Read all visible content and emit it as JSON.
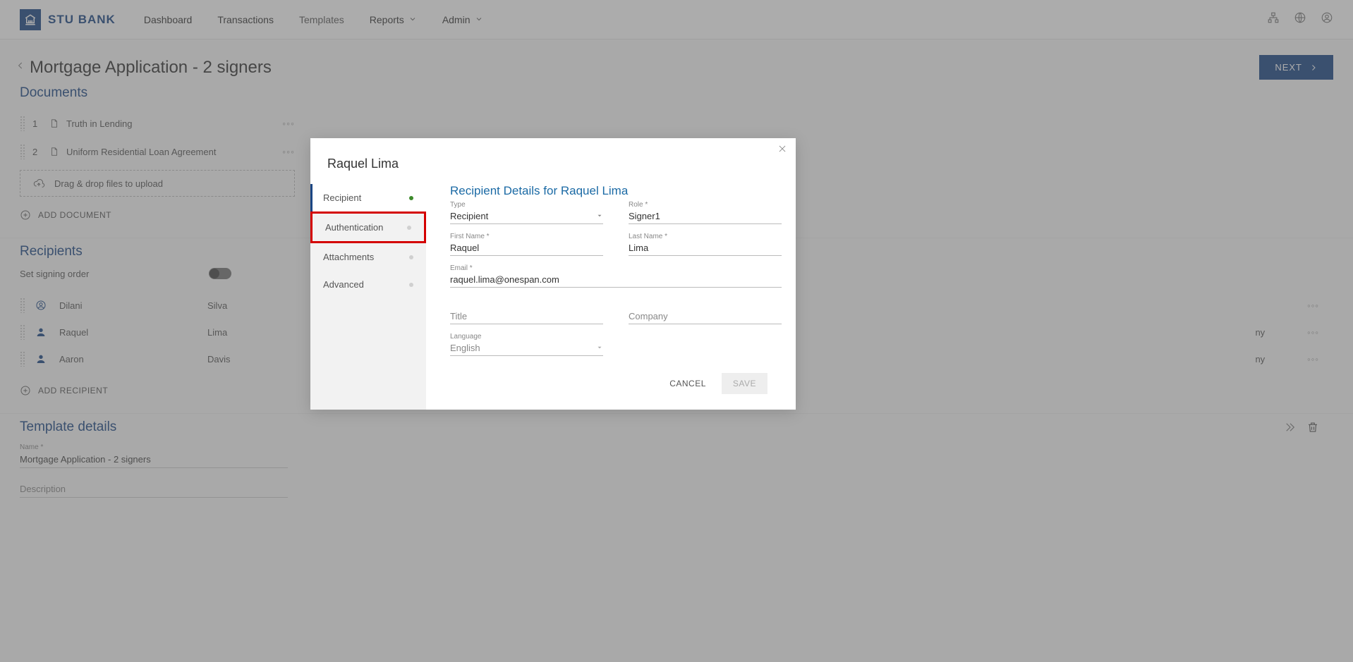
{
  "brand": {
    "name": "STU BANK"
  },
  "nav": {
    "items": [
      {
        "label": "Dashboard"
      },
      {
        "label": "Transactions"
      },
      {
        "label": "Templates"
      },
      {
        "label": "Reports"
      },
      {
        "label": "Admin"
      }
    ]
  },
  "page": {
    "title": "Mortgage Application - 2 signers",
    "next": "NEXT"
  },
  "documents": {
    "heading": "Documents",
    "items": [
      {
        "num": "1",
        "name": "Truth in Lending"
      },
      {
        "num": "2",
        "name": "Uniform Residential Loan Agreement"
      }
    ],
    "drop": "Drag & drop files to upload",
    "add": "ADD DOCUMENT"
  },
  "recipients": {
    "heading": "Recipients",
    "order_label": "Set signing order",
    "items": [
      {
        "first": "Dilani",
        "last": "Silva",
        "me": true
      },
      {
        "first": "Raquel",
        "last": "Lima",
        "me": false
      },
      {
        "first": "Aaron",
        "last": "Davis",
        "me": false
      }
    ],
    "truncated": "ny",
    "add": "ADD RECIPIENT"
  },
  "details": {
    "heading": "Template details",
    "name_label": "Name *",
    "name_value": "Mortgage Application - 2 signers",
    "desc_label": "Description"
  },
  "modal": {
    "title": "Raquel Lima",
    "tabs": [
      {
        "label": "Recipient",
        "status": "green",
        "active": true
      },
      {
        "label": "Authentication",
        "status": "grey",
        "highlight": true
      },
      {
        "label": "Attachments",
        "status": "grey"
      },
      {
        "label": "Advanced",
        "status": "grey"
      }
    ],
    "form": {
      "title": "Recipient Details for Raquel Lima",
      "type": {
        "label": "Type",
        "value": "Recipient"
      },
      "role": {
        "label": "Role *",
        "value": "Signer1"
      },
      "first": {
        "label": "First Name *",
        "value": "Raquel"
      },
      "last": {
        "label": "Last Name *",
        "value": "Lima"
      },
      "email": {
        "label": "Email *",
        "value": "raquel.lima@onespan.com"
      },
      "title_field": {
        "label": "",
        "placeholder": "Title"
      },
      "company": {
        "label": "",
        "placeholder": "Company"
      },
      "language": {
        "label": "Language",
        "value": "English"
      }
    },
    "actions": {
      "cancel": "CANCEL",
      "save": "SAVE"
    }
  }
}
